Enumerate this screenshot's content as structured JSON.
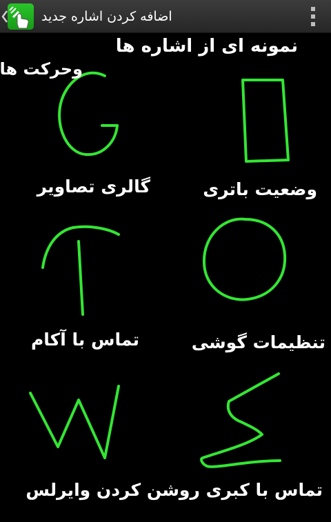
{
  "actionbar": {
    "title": "اضافه کردن اشاره جدید",
    "up_icon": "chevron-left-icon",
    "app_icon": "tap-gesture-hand-icon",
    "menu_icon": "overflow-vertical-dots-icon"
  },
  "content": {
    "heading_line1": "نمونه ای از اشاره ها",
    "heading_line2": "وحرکت ها",
    "labels": {
      "gallery": "گالری تصاویر",
      "battery": "وضعیت باتری",
      "call_akam": "تماس با آکام",
      "settings": "تنظیمات گوشی",
      "call_wifi": "تماس با کبری روشن کردن وایرلس"
    },
    "gestures": [
      "G",
      "rectangle",
      "T",
      "O",
      "W",
      "Z"
    ]
  },
  "colors": {
    "background": "#000000",
    "stroke": "#33e633",
    "text": "#ffffff",
    "icon_green": "#22b822"
  }
}
